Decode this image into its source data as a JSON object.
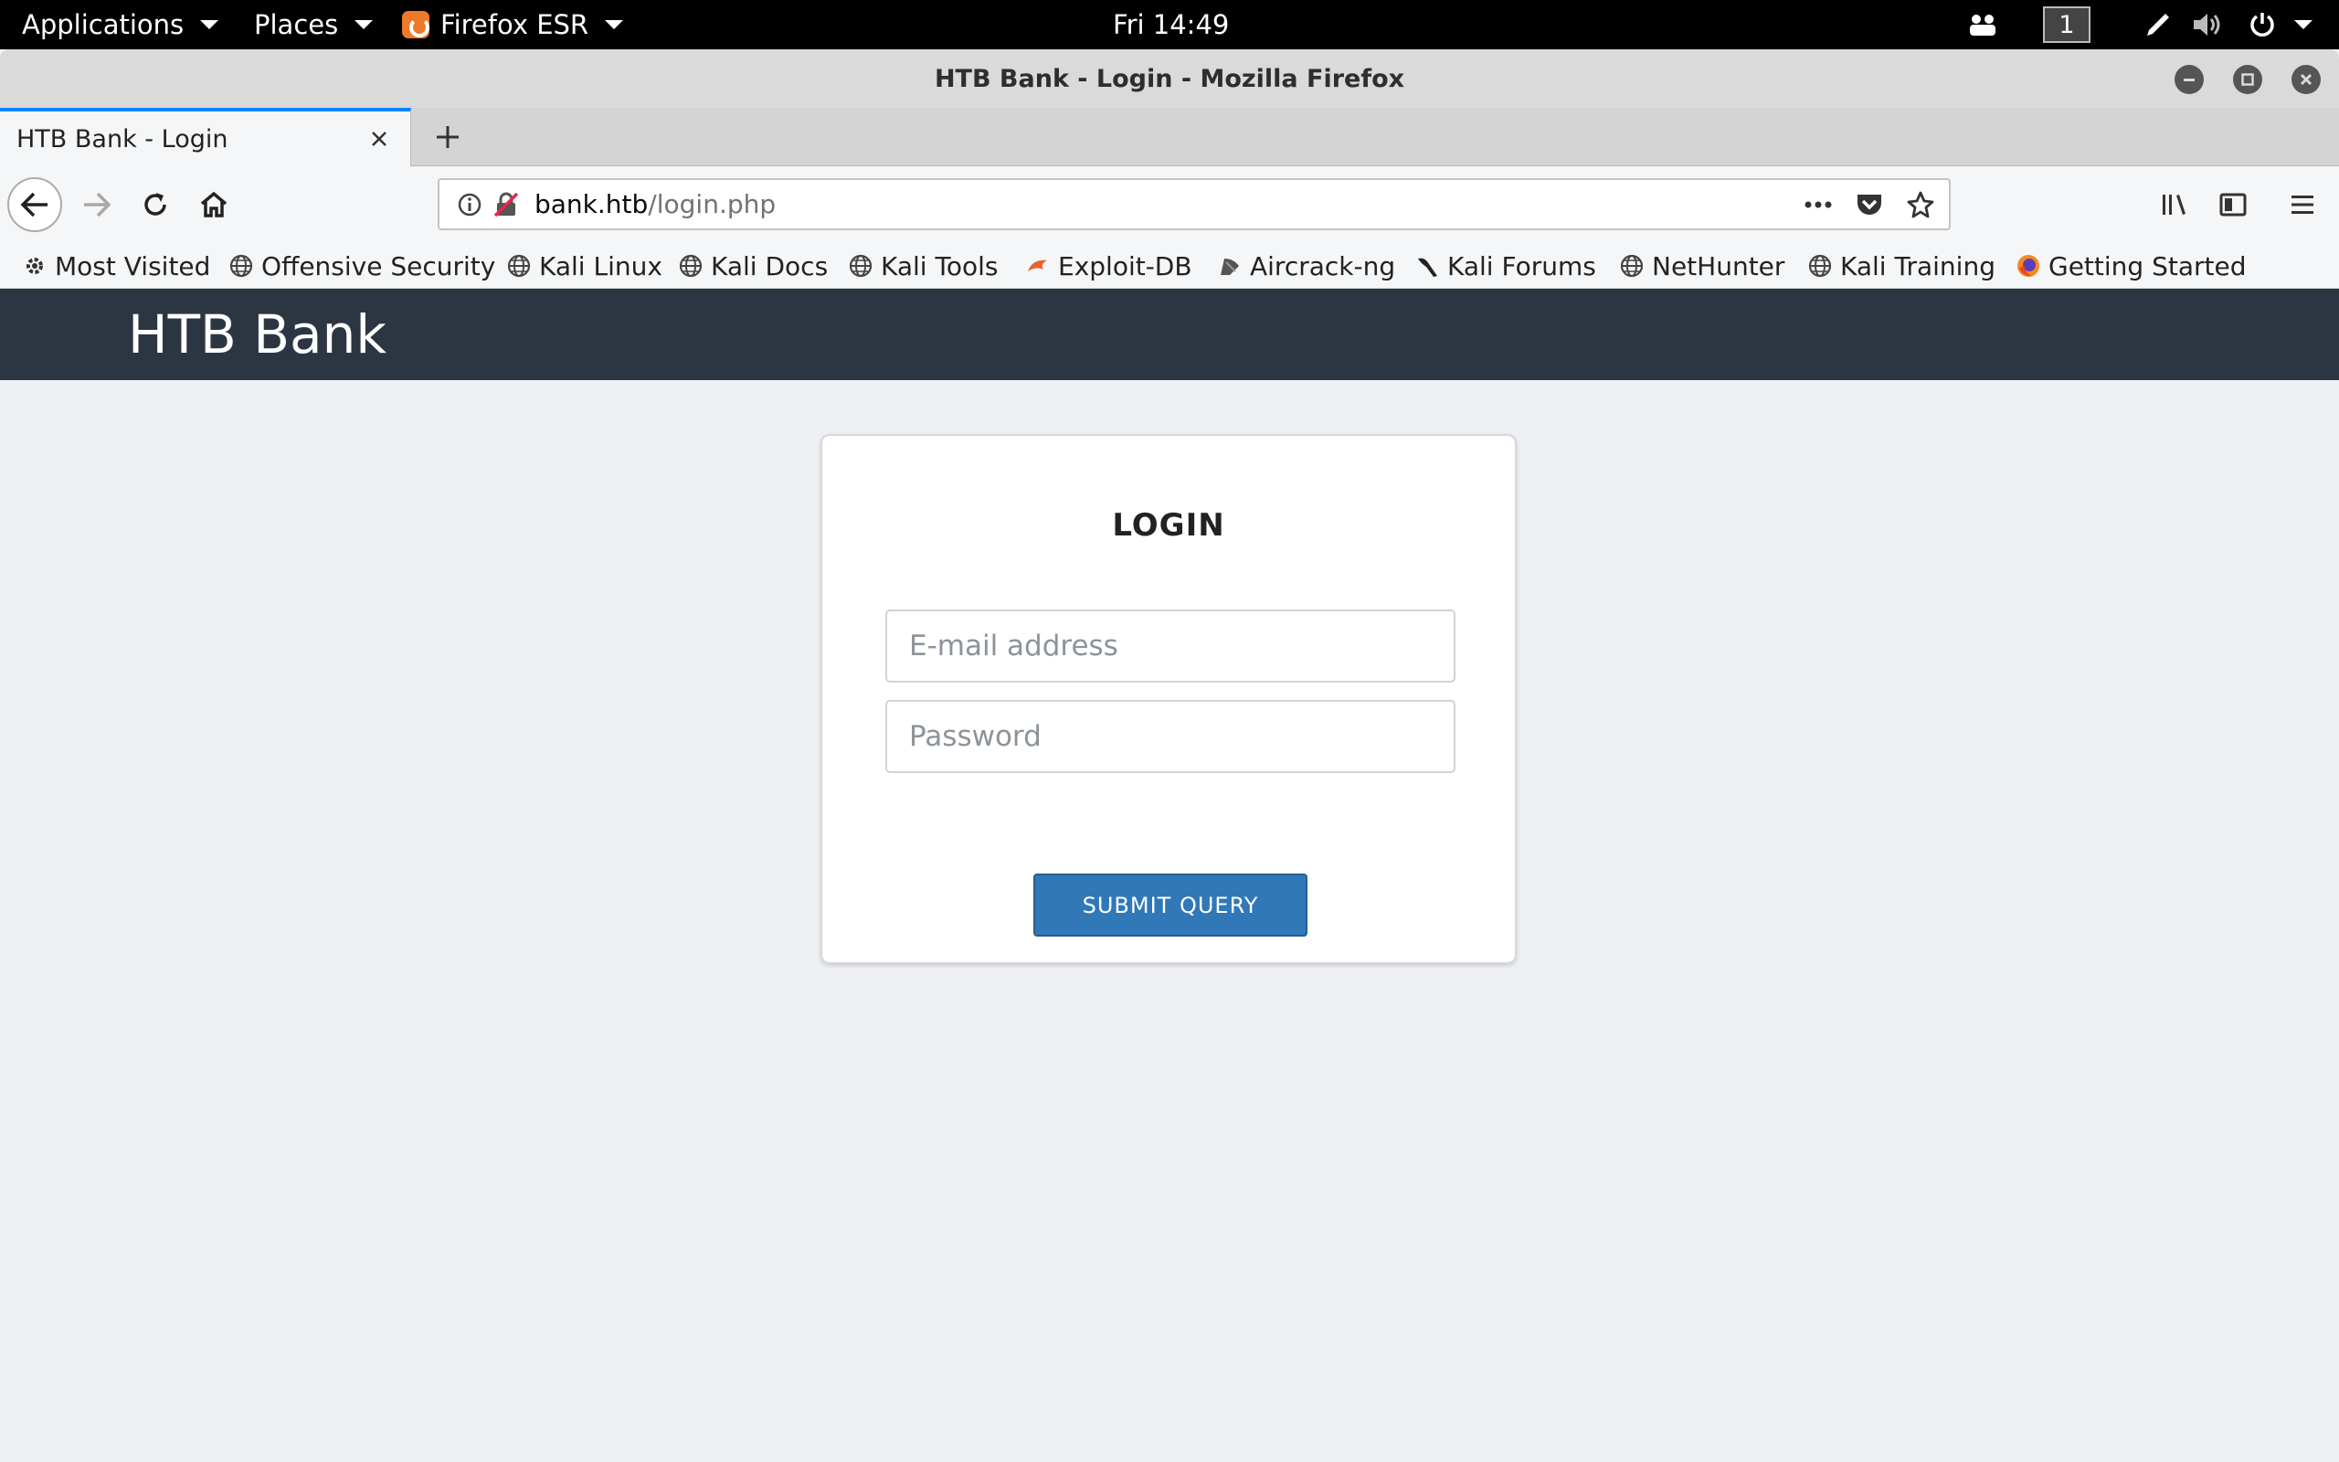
{
  "system_bar": {
    "applications": "Applications",
    "places": "Places",
    "active_app": "Firefox ESR",
    "clock": "Fri 14:49",
    "workspace": "1"
  },
  "window": {
    "title": "HTB Bank - Login - Mozilla Firefox"
  },
  "tabs": [
    {
      "title": "HTB Bank - Login",
      "active": true
    }
  ],
  "urlbar": {
    "host": "bank.htb",
    "path": "/login.php"
  },
  "bookmarks": [
    {
      "label": "Most Visited",
      "icon": "gear-icon"
    },
    {
      "label": "Offensive Security",
      "icon": "globe-icon"
    },
    {
      "label": "Kali Linux",
      "icon": "globe-icon"
    },
    {
      "label": "Kali Docs",
      "icon": "globe-icon"
    },
    {
      "label": "Kali Tools",
      "icon": "globe-icon"
    },
    {
      "label": "Exploit-DB",
      "icon": "exploitdb-icon"
    },
    {
      "label": "Aircrack-ng",
      "icon": "aircrack-icon"
    },
    {
      "label": "Kali Forums",
      "icon": "kali-dragon-icon"
    },
    {
      "label": "NetHunter",
      "icon": "globe-icon"
    },
    {
      "label": "Kali Training",
      "icon": "globe-icon"
    },
    {
      "label": "Getting Started",
      "icon": "firefox-icon"
    }
  ],
  "page": {
    "brand": "HTB Bank",
    "login": {
      "title": "LOGIN",
      "email_placeholder": "E-mail address",
      "email_value": "",
      "password_placeholder": "Password",
      "password_value": "",
      "submit_label": "SUBMIT QUERY"
    }
  },
  "colors": {
    "header_bg": "#2c3643",
    "page_bg": "#eef0f4",
    "button_bg": "#3078b8",
    "tab_accent": "#0a84ff"
  }
}
